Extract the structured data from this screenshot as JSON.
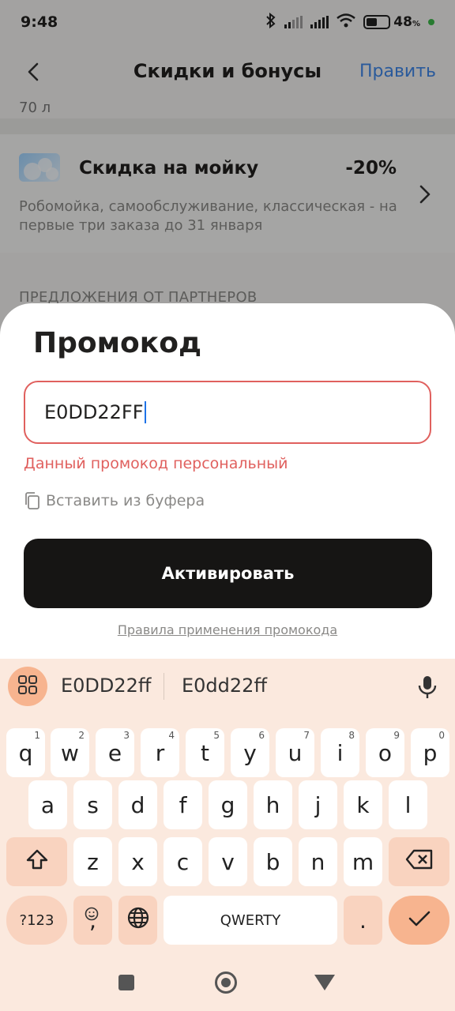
{
  "status": {
    "time": "9:48",
    "battery": "48",
    "battery_unit": "%"
  },
  "header": {
    "title": "Скидки и бонусы",
    "edit_label": "Править"
  },
  "background": {
    "liters_text": "70 л",
    "discount": {
      "title": "Скидка на мойку",
      "value": "-20%",
      "description": "Робомойка, самообслуживание, классическая - на первые три заказа до 31 января"
    },
    "partners_heading": "ПРЕДЛОЖЕНИЯ ОТ ПАРТНЕРОВ"
  },
  "sheet": {
    "title": "Промокод",
    "input_value": "E0DD22FF",
    "error": "Данный промокод персональный",
    "paste_label": "Вставить из буфера",
    "activate_label": "Активировать",
    "rules_link": "Правила применения промокода"
  },
  "keyboard": {
    "suggestions": [
      "E0DD22ff",
      "E0dd22ff"
    ],
    "row1": [
      {
        "k": "q",
        "n": "1"
      },
      {
        "k": "w",
        "n": "2"
      },
      {
        "k": "e",
        "n": "3"
      },
      {
        "k": "r",
        "n": "4"
      },
      {
        "k": "t",
        "n": "5"
      },
      {
        "k": "y",
        "n": "6"
      },
      {
        "k": "u",
        "n": "7"
      },
      {
        "k": "i",
        "n": "8"
      },
      {
        "k": "o",
        "n": "9"
      },
      {
        "k": "p",
        "n": "0"
      }
    ],
    "row2": [
      "a",
      "s",
      "d",
      "f",
      "g",
      "h",
      "j",
      "k",
      "l"
    ],
    "row3": [
      "z",
      "x",
      "c",
      "v",
      "b",
      "n",
      "m"
    ],
    "numbers_label": "?123",
    "comma_label": ",",
    "space_label": "QWERTY",
    "period_label": ".",
    "colors": {
      "background": "#fbe9de",
      "accent": "#f7b48f",
      "func": "#f9d3bf"
    }
  },
  "colors": {
    "error": "#e0605e",
    "link": "#3f86e8",
    "button": "#161514"
  }
}
